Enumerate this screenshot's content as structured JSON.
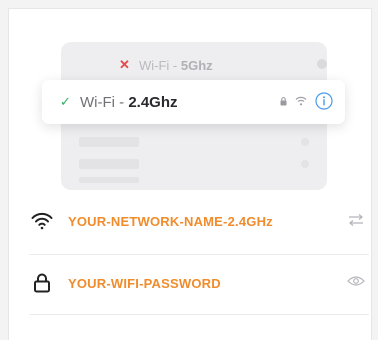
{
  "networks": {
    "row_5g": {
      "status": "unavailable",
      "label_prefix": "Wi-Fi - ",
      "label_band": "5Ghz"
    },
    "row_24": {
      "status": "connected",
      "label_prefix": "Wi-Fi - ",
      "label_band": "2.4Ghz"
    }
  },
  "fields": {
    "network_name": {
      "value": "YOUR-NETWORK-NAME-2.4GHz",
      "icon": "wifi-icon",
      "action_icon": "swap-icon"
    },
    "password": {
      "value": "YOUR-WIFI-PASSWORD",
      "icon": "lock-icon",
      "action_icon": "eye-icon"
    }
  },
  "colors": {
    "accent": "#f08c2c",
    "connected": "#2fae5c",
    "error": "#e64848",
    "info": "#4a9be8"
  }
}
